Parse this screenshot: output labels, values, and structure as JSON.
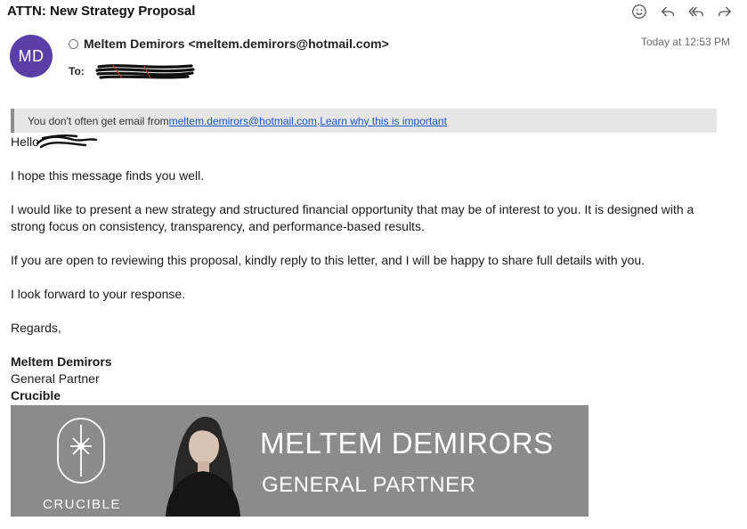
{
  "header": {
    "subject": "ATTN: New Strategy Proposal",
    "toolbar": {
      "icons": [
        "emoji-icon",
        "reply-icon",
        "reply-all-icon",
        "forward-icon"
      ]
    }
  },
  "message": {
    "avatar_initials": "MD",
    "avatar_color": "#5b3fa8",
    "sender": "Meltem Demirors <meltem.demirors@hotmail.com>",
    "to_label": "To:",
    "timestamp": "Today at 12:53 PM"
  },
  "banner": {
    "prefix": "You don't often get email from ",
    "email_link": "meltem.demirors@hotmail.com",
    "separator": ". ",
    "learn_link": "Learn why this is important",
    "link_color": "#1a55c9"
  },
  "body": {
    "greeting": "Hello",
    "p1": "I hope this message finds you well.",
    "p2": "I would like to present a new strategy and structured financial opportunity that may be of interest to you. It is designed with a strong focus on consistency, transparency, and performance-based results.",
    "p3": "If you are open to reviewing this proposal, kindly reply to this letter, and I will be happy to share full details with you.",
    "p4": "I look forward to your response.",
    "closing": "Regards,"
  },
  "signature": {
    "name": "Meltem Demirors",
    "role": "General Partner",
    "company": "Crucible",
    "banner": {
      "logo_text": "CRUCIBLE",
      "name": "MELTEM DEMIRORS",
      "role": "GENERAL PARTNER",
      "background": "#8c8b89"
    }
  }
}
